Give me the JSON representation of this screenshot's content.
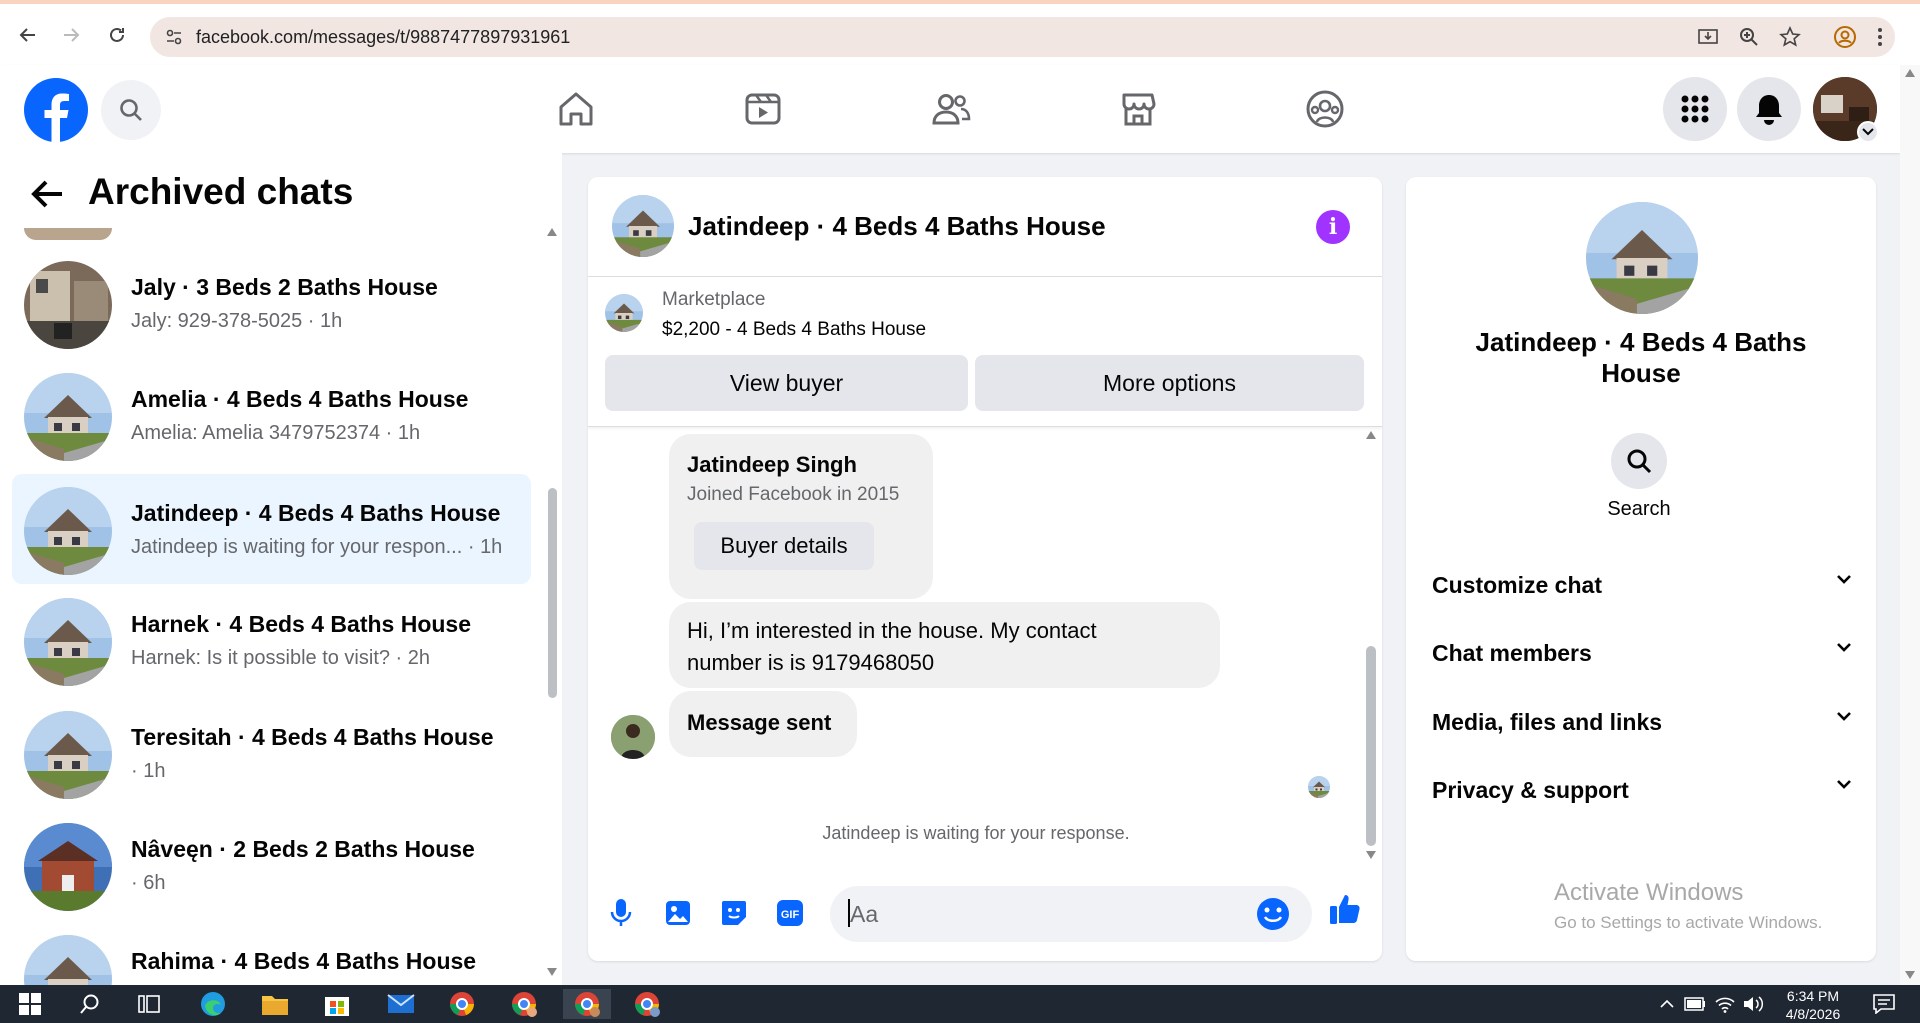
{
  "browser": {
    "url": "facebook.com/messages/t/9887477897931961"
  },
  "header": {
    "logo": "facebook-logo",
    "nav_icons": [
      "home-icon",
      "video-icon",
      "friends-icon",
      "marketplace-icon",
      "groups-icon"
    ]
  },
  "sidebar": {
    "title": "Archived chats",
    "chats": [
      {
        "name": "Jaly · 3 Beds 2 Baths House",
        "preview": "Jaly: 929-378-5025 · 1h"
      },
      {
        "name": "Amelia · 4 Beds 4 Baths House",
        "preview": "Amelia: Amelia 3479752374 · 1h"
      },
      {
        "name": "Jatindeep · 4 Beds 4 Baths House",
        "preview": "Jatindeep is waiting for your respon... · 1h"
      },
      {
        "name": "Harnek · 4 Beds 4 Baths House",
        "preview": "Harnek: Is it possible to visit? · 2h"
      },
      {
        "name": "Teresitah · 4 Beds 4 Baths House",
        "preview": "· 1h"
      },
      {
        "name": "Nâveęn · 2 Beds 2 Baths House",
        "preview": "· 6h"
      },
      {
        "name": "Rahima · 4 Beds 4 Baths House",
        "preview": ""
      }
    ]
  },
  "conversation": {
    "title": "Jatindeep · 4 Beds 4 Baths House",
    "marketplace_label": "Marketplace",
    "listing": "$2,200 - 4 Beds 4 Baths House",
    "view_buyer_label": "View buyer",
    "more_options_label": "More options",
    "buyer_name": "Jatindeep Singh",
    "buyer_joined": "Joined Facebook in 2015",
    "buyer_details_label": "Buyer details",
    "message_line1": "Hi, I’m interested in the house. My contact",
    "message_line2": "number is is 9179468050",
    "sent_message": "Message sent",
    "waiting_text": "Jatindeep is waiting for your response.",
    "composer_placeholder": "Aa"
  },
  "details": {
    "title_line1": "Jatindeep · 4 Beds 4 Baths",
    "title_line2": "House",
    "search_label": "Search",
    "sections": [
      "Customize chat",
      "Chat members",
      "Media, files and links",
      "Privacy & support"
    ],
    "watermark_title": "Activate Windows",
    "watermark_sub": "Go to Settings to activate Windows."
  },
  "taskbar": {
    "time": "6:34 PM",
    "date": "4/8/2026"
  },
  "colors": {
    "fb_blue": "#0866ff",
    "accent_purple": "#a033ff",
    "active_chat": "#ebf5ff"
  }
}
